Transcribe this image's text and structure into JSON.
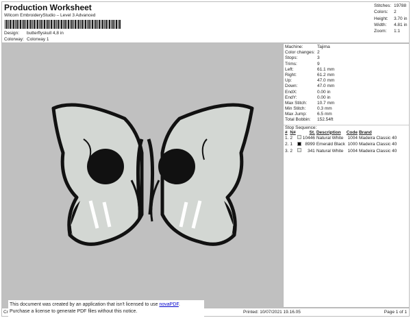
{
  "header": {
    "title": "Production Worksheet",
    "subtitle": "Wilcom EmbroideryStudio – Level 3 Advanced",
    "design_label": "Design:",
    "design_value": "butterflyskull 4,8 in",
    "colorway_label": "Colorway:",
    "colorway_value": "Colorway 1"
  },
  "stats": [
    {
      "k": "Stitches:",
      "v": "19788"
    },
    {
      "k": "Colors:",
      "v": "2"
    },
    {
      "k": "Height:",
      "v": "3.70 in"
    },
    {
      "k": "Width:",
      "v": "4.81 in"
    },
    {
      "k": "Zoom:",
      "v": "1:1"
    }
  ],
  "details": [
    {
      "k": "Machine:",
      "v": "Tajima"
    },
    {
      "k": "Color changes:",
      "v": "2"
    },
    {
      "k": "Stops:",
      "v": "3"
    },
    {
      "k": "Trims:",
      "v": "9"
    },
    {
      "k": "Left:",
      "v": "61.1 mm"
    },
    {
      "k": "Right:",
      "v": "61.2 mm"
    },
    {
      "k": "Up:",
      "v": "47.0 mm"
    },
    {
      "k": "Down:",
      "v": "47.0 mm"
    },
    {
      "k": "EndX:",
      "v": "0.00 in"
    },
    {
      "k": "EndY:",
      "v": "0.00 in"
    },
    {
      "k": "Max Stitch:",
      "v": "10.7 mm"
    },
    {
      "k": "Min Stitch:",
      "v": "0.3 mm"
    },
    {
      "k": "Max Jump:",
      "v": "6.5 mm"
    },
    {
      "k": "Total Bobbin:",
      "v": "152.54ft"
    }
  ],
  "stop_sequence": {
    "title": "Stop Sequence:",
    "headers": [
      "#",
      "N#",
      "",
      "St.",
      "Description",
      "Code",
      "Brand"
    ],
    "rows": [
      {
        "n": "1.",
        "nn": "2",
        "color": "#e8ece8",
        "st": "10446",
        "desc": "Natural White",
        "code": "1004",
        "brand": "Madeira Classic 40"
      },
      {
        "n": "2.",
        "nn": "1",
        "color": "#000000",
        "st": "8999",
        "desc": "Emerald Black",
        "code": "1000",
        "brand": "Madeira Classic 40"
      },
      {
        "n": "3.",
        "nn": "2",
        "color": "#e8ece8",
        "st": "341",
        "desc": "Natural White",
        "code": "1004",
        "brand": "Madeira Classic 40"
      }
    ]
  },
  "footer": {
    "left": "Cr",
    "printed": "Printed: 10/07/2021 19.16.05",
    "page": "Page 1 of 1"
  },
  "notice": {
    "line1": "This document was created by an application that isn't licensed to use ",
    "link": "novaPDF",
    "line1_end": ".",
    "line2": "Purchase a license to generate PDF files without this notice."
  }
}
